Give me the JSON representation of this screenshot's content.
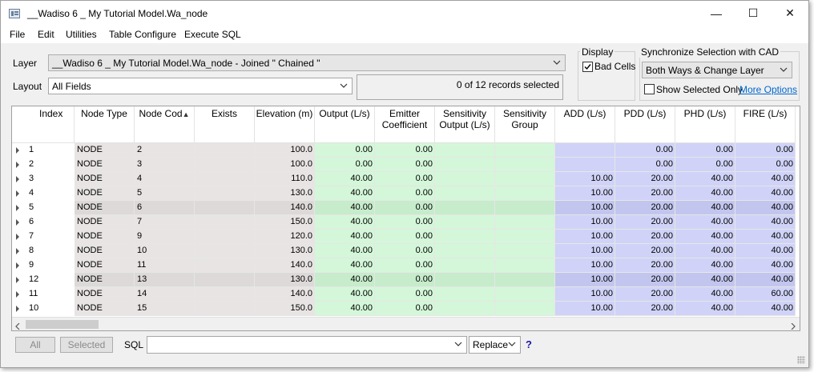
{
  "window": {
    "title": "__Wadiso 6 _ My Tutorial Model.Wa_node",
    "minimize_glyph": "—",
    "maximize_glyph": "☐",
    "close_glyph": "✕"
  },
  "menu": [
    "File",
    "Edit",
    "Utilities",
    "Table Configure",
    "Execute SQL"
  ],
  "layer": {
    "label": "Layer",
    "value": "__Wadiso 6 _ My Tutorial Model.Wa_node - Joined \" Chained \""
  },
  "layout": {
    "label": "Layout",
    "value": "All Fields"
  },
  "records_selected": "0 of 12 records selected",
  "display": {
    "title": "Display",
    "bad_cells_label": "Bad Cells",
    "bad_cells_checked": true
  },
  "sync": {
    "title": "Synchronize Selection with CAD",
    "value": "Both Ways & Change Layer",
    "show_selected_only_label": "Show Selected Only",
    "show_selected_only_checked": false,
    "more_options": "More Options"
  },
  "table": {
    "columns": [
      "Index",
      "Node Type",
      "Node Cod",
      "Exists",
      "Elevation (m)",
      "Output (L/s)",
      "Emitter Coefficient",
      "Sensitivity Output (L/s)",
      "Sensitivity Group",
      "ADD (L/s)",
      "PDD (L/s)",
      "PHD (L/s)",
      "FIRE (L/s)"
    ],
    "sorted_column": "Node Cod",
    "sort_glyph": "▲",
    "rows": [
      [
        "1",
        "NODE",
        "2",
        "",
        "100.0",
        "0.00",
        "0.00",
        "",
        "",
        "",
        "0.00",
        "0.00",
        "0.00"
      ],
      [
        "2",
        "NODE",
        "3",
        "",
        "100.0",
        "0.00",
        "0.00",
        "",
        "",
        "",
        "0.00",
        "0.00",
        "0.00"
      ],
      [
        "3",
        "NODE",
        "4",
        "",
        "110.0",
        "40.00",
        "0.00",
        "",
        "",
        "10.00",
        "20.00",
        "40.00",
        "40.00"
      ],
      [
        "4",
        "NODE",
        "5",
        "",
        "130.0",
        "40.00",
        "0.00",
        "",
        "",
        "10.00",
        "20.00",
        "40.00",
        "40.00"
      ],
      [
        "5",
        "NODE",
        "6",
        "",
        "140.0",
        "40.00",
        "0.00",
        "",
        "",
        "10.00",
        "20.00",
        "40.00",
        "40.00"
      ],
      [
        "6",
        "NODE",
        "7",
        "",
        "150.0",
        "40.00",
        "0.00",
        "",
        "",
        "10.00",
        "20.00",
        "40.00",
        "40.00"
      ],
      [
        "7",
        "NODE",
        "9",
        "",
        "120.0",
        "40.00",
        "0.00",
        "",
        "",
        "10.00",
        "20.00",
        "40.00",
        "40.00"
      ],
      [
        "8",
        "NODE",
        "10",
        "",
        "130.0",
        "40.00",
        "0.00",
        "",
        "",
        "10.00",
        "20.00",
        "40.00",
        "40.00"
      ],
      [
        "9",
        "NODE",
        "11",
        "",
        "140.0",
        "40.00",
        "0.00",
        "",
        "",
        "10.00",
        "20.00",
        "40.00",
        "40.00"
      ],
      [
        "12",
        "NODE",
        "13",
        "",
        "130.0",
        "40.00",
        "0.00",
        "",
        "",
        "10.00",
        "20.00",
        "40.00",
        "40.00"
      ],
      [
        "11",
        "NODE",
        "14",
        "",
        "140.0",
        "40.00",
        "0.00",
        "",
        "",
        "10.00",
        "20.00",
        "40.00",
        "60.00"
      ],
      [
        "10",
        "NODE",
        "15",
        "",
        "150.0",
        "40.00",
        "0.00",
        "",
        "",
        "10.00",
        "20.00",
        "40.00",
        "40.00"
      ]
    ]
  },
  "colors": {
    "gray_cell": "#e8e4e4",
    "gray_cell_alt": "#ddd9d9",
    "green_cell": "#d4f7d9",
    "green_cell_alt": "#c6eccb",
    "blue_cell": "#d0d3f7",
    "blue_cell_alt": "#c2c6ee",
    "link": "#0066cc"
  },
  "bottom": {
    "all_label": "All",
    "selected_label": "Selected",
    "sql_label": "SQL",
    "sql_value": "",
    "replace_value": "Replace",
    "help_glyph": "?"
  }
}
